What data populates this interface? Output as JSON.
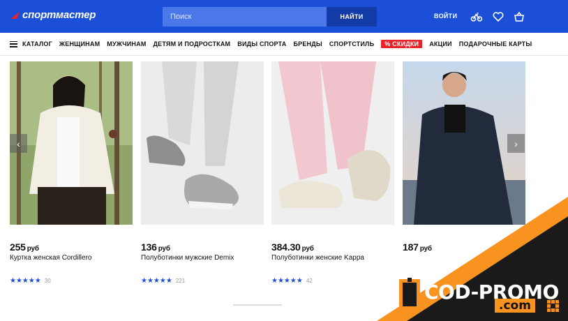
{
  "header": {
    "logo_text": "спортмастер",
    "search_placeholder": "Поиск",
    "search_button": "НАЙТИ",
    "login": "ВОЙТИ"
  },
  "nav": {
    "items": [
      "КАТАЛОГ",
      "ЖЕНЩИНАМ",
      "МУЖЧИНАМ",
      "ДЕТЯМ И ПОДРОСТКАМ",
      "ВИДЫ СПОРТА",
      "БРЕНДЫ",
      "СПОРТСТИЛЬ",
      "% СКИДКИ",
      "АКЦИИ",
      "ПОДАРОЧНЫЕ КАРТЫ"
    ]
  },
  "products": [
    {
      "price": "255",
      "currency": "руб",
      "name": "Куртка женская Cordillero",
      "stars": "★★★★★",
      "reviews": "30"
    },
    {
      "price": "136",
      "currency": "руб",
      "name": "Полуботинки мужские Demix",
      "stars": "★★★★★",
      "reviews": "221"
    },
    {
      "price": "384.30",
      "currency": "руб",
      "name": "Полуботинки женские Kappa",
      "stars": "★★★★★",
      "reviews": "42"
    },
    {
      "price": "187",
      "currency": "руб",
      "name": "",
      "stars": "",
      "reviews": ""
    }
  ],
  "promo": {
    "main": "COD-PROMO",
    "sub": ".com"
  },
  "colors": {
    "brand": "#1b4fd8",
    "sale": "#e8232a",
    "promo_orange": "#f7931e",
    "promo_dark": "#1a1a1a"
  },
  "icons": [
    "bike-icon",
    "heart-icon",
    "cart-icon",
    "arrow-left-icon",
    "arrow-right-icon",
    "menu-icon"
  ]
}
